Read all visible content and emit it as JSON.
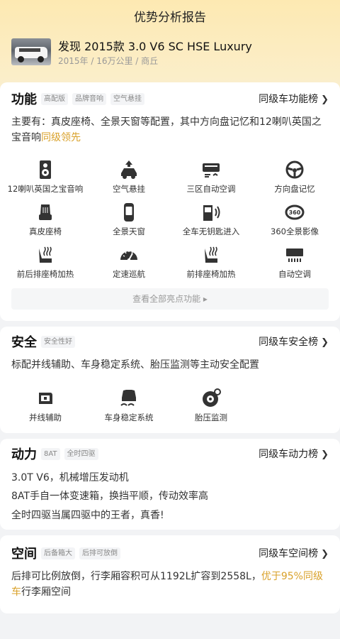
{
  "header": {
    "title": "优势分析报告"
  },
  "car": {
    "name": "发现 2015款 3.0 V6 SC HSE Luxury",
    "subtitle": "2015年 / 16万公里 / 商丘"
  },
  "function_section": {
    "title": "功能",
    "tags": [
      "高配版",
      "品牌音响",
      "空气悬挂"
    ],
    "rank_label": "同级车功能榜",
    "desc_main": "主要有：真皮座椅、全景天窗等配置，其中方向盘记忆和12喇叭英国之宝音响",
    "desc_highlight": "同级领先",
    "items": [
      {
        "label": "12喇叭英国之宝音响",
        "icon": "speaker-icon"
      },
      {
        "label": "空气悬挂",
        "icon": "air-suspension-icon"
      },
      {
        "label": "三区自动空调",
        "icon": "climate-control-icon"
      },
      {
        "label": "方向盘记忆",
        "icon": "steering-wheel-icon"
      },
      {
        "label": "真皮座椅",
        "icon": "leather-seat-icon"
      },
      {
        "label": "全景天窗",
        "icon": "sunroof-icon"
      },
      {
        "label": "全车无钥匙进入",
        "icon": "keyless-entry-icon"
      },
      {
        "label": "360全景影像",
        "icon": "camera-360-icon"
      },
      {
        "label": "前后排座椅加热",
        "icon": "seat-heating-icon"
      },
      {
        "label": "定速巡航",
        "icon": "cruise-control-icon"
      },
      {
        "label": "前排座椅加热",
        "icon": "front-seat-heating-icon"
      },
      {
        "label": "自动空调",
        "icon": "auto-ac-icon"
      }
    ],
    "view_all": "查看全部亮点功能 ▸"
  },
  "safety_section": {
    "title": "安全",
    "tags": [
      "安全性好"
    ],
    "rank_label": "同级车安全榜",
    "desc": "标配并线辅助、车身稳定系统、胎压监测等主动安全配置",
    "items": [
      {
        "label": "并线辅助",
        "icon": "lane-assist-icon"
      },
      {
        "label": "车身稳定系统",
        "icon": "stability-control-icon"
      },
      {
        "label": "胎压监测",
        "icon": "tire-pressure-icon"
      }
    ]
  },
  "power_section": {
    "title": "动力",
    "tags": [
      "8AT",
      "全时四驱"
    ],
    "rank_label": "同级车动力榜",
    "lines": [
      "3.0T V6，机械增压发动机",
      "8AT手自一体变速箱，换挡平顺，传动效率高",
      "全时四驱当属四驱中的王者，真香!"
    ]
  },
  "space_section": {
    "title": "空间",
    "tags": [
      "后备箱大",
      "后排可放倒"
    ],
    "rank_label": "同级车空间榜",
    "desc_main": "后排可比例放倒，行李厢容积可从1192L扩容到2558L，",
    "desc_highlight": "优于95%同级车",
    "desc_tail": "行李厢空间"
  },
  "colors": {
    "accent": "#d9a12a",
    "header_bg": "#fde9b2",
    "page_bg": "#f2f3f5"
  }
}
